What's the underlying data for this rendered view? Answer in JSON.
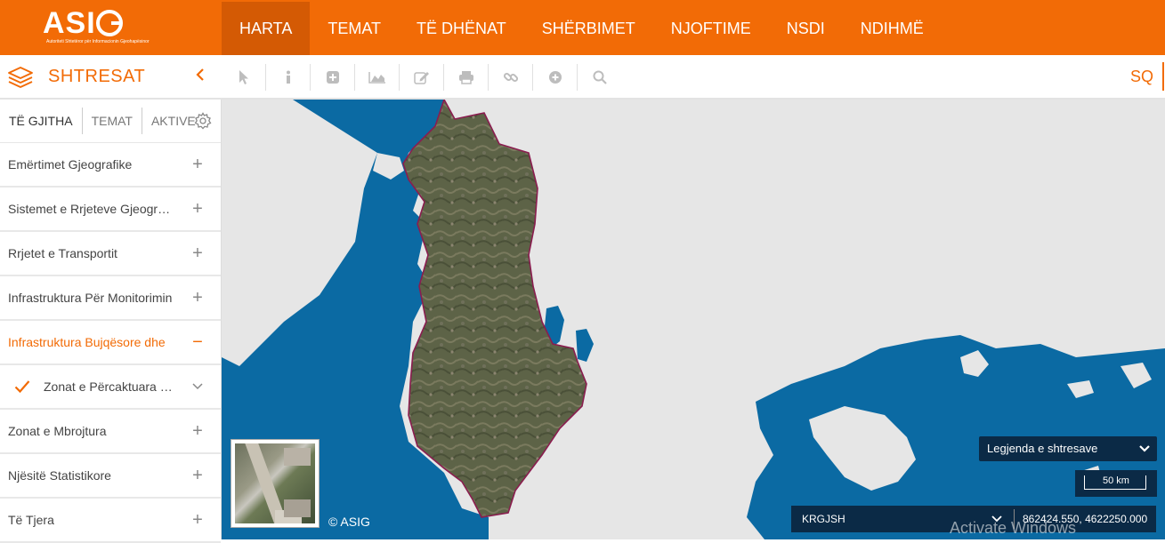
{
  "logo": {
    "name": "ASIG",
    "tagline": "Autoriteti Shtetëror për Informacionin Gjeohapësinor"
  },
  "nav": {
    "items": [
      {
        "label": "HARTA",
        "active": true
      },
      {
        "label": "TEMAT"
      },
      {
        "label": "TË DHËNAT"
      },
      {
        "label": "SHËRBIMET"
      },
      {
        "label": "NJOFTIME"
      },
      {
        "label": "NSDI"
      },
      {
        "label": "NDIHMË"
      }
    ]
  },
  "toolbar": {
    "panel_title": "SHTRESAT",
    "collapse_icon": "chevron-left-icon",
    "tools": [
      "pointer-icon",
      "info-icon",
      "plus-square-icon",
      "area-chart-icon",
      "edit-icon",
      "print-icon",
      "link-icon",
      "plus-circle-icon",
      "search-icon"
    ],
    "language": "SQ"
  },
  "sidebar": {
    "tabs": {
      "all": "TË GJITHA",
      "themes": "TEMAT",
      "active": "AKTIVE"
    },
    "rows": [
      {
        "label": "Emërtimet Gjeografike"
      },
      {
        "label": "Sistemet e Rrjeteve Gjeografike"
      },
      {
        "label": "Rrjetet e Transportit"
      },
      {
        "label": "Infrastruktura Për Monitorimin"
      },
      {
        "label": "Infrastruktura Bujqësore dhe"
      },
      {
        "label": "Zonat e Përcaktuara për"
      },
      {
        "label": "Zonat e Mbrojtura"
      },
      {
        "label": "Njësitë Statistikore"
      },
      {
        "label": "Të Tjera"
      }
    ]
  },
  "map": {
    "copyright": "© ASIG",
    "legend_label": "Legjenda e shtresave",
    "scale_label": "50 km",
    "crs": "KRGJSH",
    "coordinates": "862424.550, 4622250.000",
    "watermark": "Activate Windows",
    "colors": {
      "sea": "#0b6aa3",
      "land": "#e6e6e6",
      "country_border": "#8a1d4f",
      "accent": "#f26b06"
    }
  }
}
